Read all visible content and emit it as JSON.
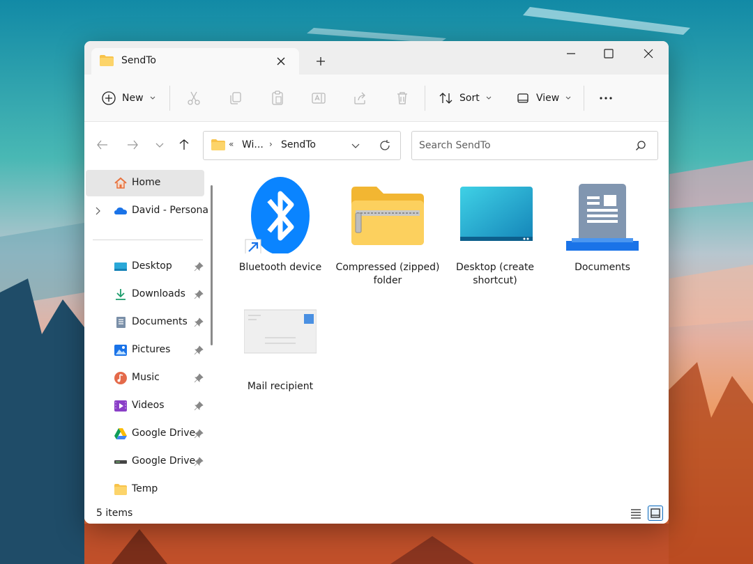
{
  "tab": {
    "title": "SendTo"
  },
  "toolbar": {
    "new_label": "New",
    "sort_label": "Sort",
    "view_label": "View"
  },
  "address": {
    "segment1": "Wi...",
    "segment2": "SendTo"
  },
  "search": {
    "placeholder": "Search SendTo"
  },
  "sidebar": {
    "items": [
      {
        "label": "Home",
        "icon": "home-icon"
      },
      {
        "label": "David - Persona",
        "icon": "onedrive-icon"
      },
      {
        "label": "Desktop",
        "icon": "desktop-icon"
      },
      {
        "label": "Downloads",
        "icon": "downloads-icon"
      },
      {
        "label": "Documents",
        "icon": "documents-icon"
      },
      {
        "label": "Pictures",
        "icon": "pictures-icon"
      },
      {
        "label": "Music",
        "icon": "music-icon"
      },
      {
        "label": "Videos",
        "icon": "videos-icon"
      },
      {
        "label": "Google Drive",
        "icon": "google-drive-icon"
      },
      {
        "label": "Google Drive",
        "icon": "drive-icon"
      },
      {
        "label": "Temp",
        "icon": "folder-icon"
      }
    ]
  },
  "files": [
    {
      "label": "Bluetooth device",
      "icon": "bluetooth-icon"
    },
    {
      "label": "Compressed (zipped) folder",
      "icon": "zip-folder-icon"
    },
    {
      "label": "Desktop (create shortcut)",
      "icon": "desktop-shortcut-icon"
    },
    {
      "label": "Documents",
      "icon": "documents-icon"
    },
    {
      "label": "Mail recipient",
      "icon": "mail-icon"
    }
  ],
  "status": {
    "count": "5 items"
  },
  "colors": {
    "accent": "#0f6cbd",
    "folder": "#f8c34a",
    "bluetooth": "#0a84ff"
  }
}
